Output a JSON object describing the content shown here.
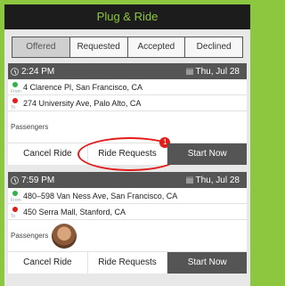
{
  "app": {
    "title": "Plug & Ride"
  },
  "tabs": [
    {
      "label": "Offered"
    },
    {
      "label": "Requested"
    },
    {
      "label": "Accepted"
    },
    {
      "label": "Declined"
    }
  ],
  "rides": [
    {
      "time": "2:24 PM",
      "date": "Thu, Jul 28",
      "from": "4 Clarence Pl, San Francisco, CA",
      "to": "274 University Ave, Palo Alto, CA",
      "passengers_label": "Passengers",
      "cancel_label": "Cancel Ride",
      "requests_label": "Ride Requests",
      "requests_count": "1",
      "start_label": "Start Now"
    },
    {
      "time": "7:59 PM",
      "date": "Thu, Jul 28",
      "from": "480–598 Van Ness Ave, San Francisco, CA",
      "to": "450 Serra Mall, Stanford, CA",
      "passengers_label": "Passengers",
      "cancel_label": "Cancel Ride",
      "requests_label": "Ride Requests",
      "start_label": "Start Now"
    }
  ],
  "route_marks": {
    "from": "From",
    "to": "To"
  },
  "colors": {
    "accent": "#8dc63f",
    "header_bg": "#1c1c1c",
    "card_head_bg": "#555555",
    "alert": "#e21b1b"
  }
}
